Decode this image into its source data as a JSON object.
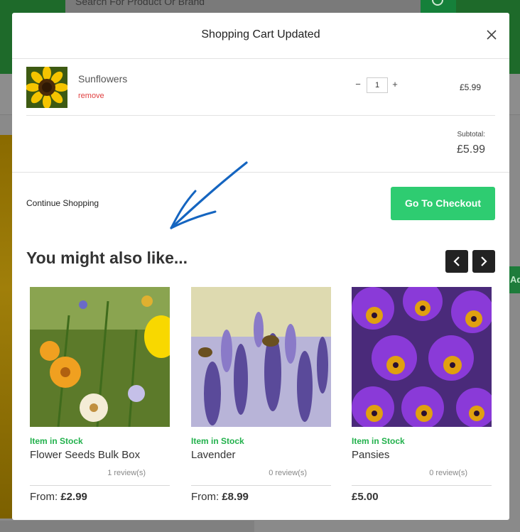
{
  "background": {
    "search_placeholder": "Search For Product Or Brand",
    "side_button_text": "Ad"
  },
  "modal": {
    "title": "Shopping Cart Updated",
    "cart_item": {
      "name": "Sunflowers",
      "remove_label": "remove",
      "quantity": "1",
      "minus_label": "−",
      "plus_label": "+",
      "price": "£5.99"
    },
    "subtotal_label": "Subtotal:",
    "subtotal_value": "£5.99",
    "continue_label": "Continue Shopping",
    "checkout_label": "Go To Checkout",
    "also_title": "You might also like...",
    "products": [
      {
        "stock": "Item in Stock",
        "name": "Flower Seeds Bulk Box",
        "reviews": "1 review(s)",
        "price_prefix": "From: ",
        "price": "£2.99"
      },
      {
        "stock": "Item in Stock",
        "name": "Lavender",
        "reviews": "0 review(s)",
        "price_prefix": "From: ",
        "price": "£8.99"
      },
      {
        "stock": "Item in Stock",
        "name": "Pansies",
        "reviews": "0 review(s)",
        "price_prefix": "",
        "price": "£5.00"
      }
    ]
  },
  "colors": {
    "accent_green": "#2ecc71",
    "stock_green": "#22b14c",
    "remove_red": "#e04040",
    "arrow_blue": "#1565c0"
  },
  "icons": [
    "close-icon",
    "chevron-left-icon",
    "chevron-right-icon",
    "annotation-arrow-icon"
  ]
}
